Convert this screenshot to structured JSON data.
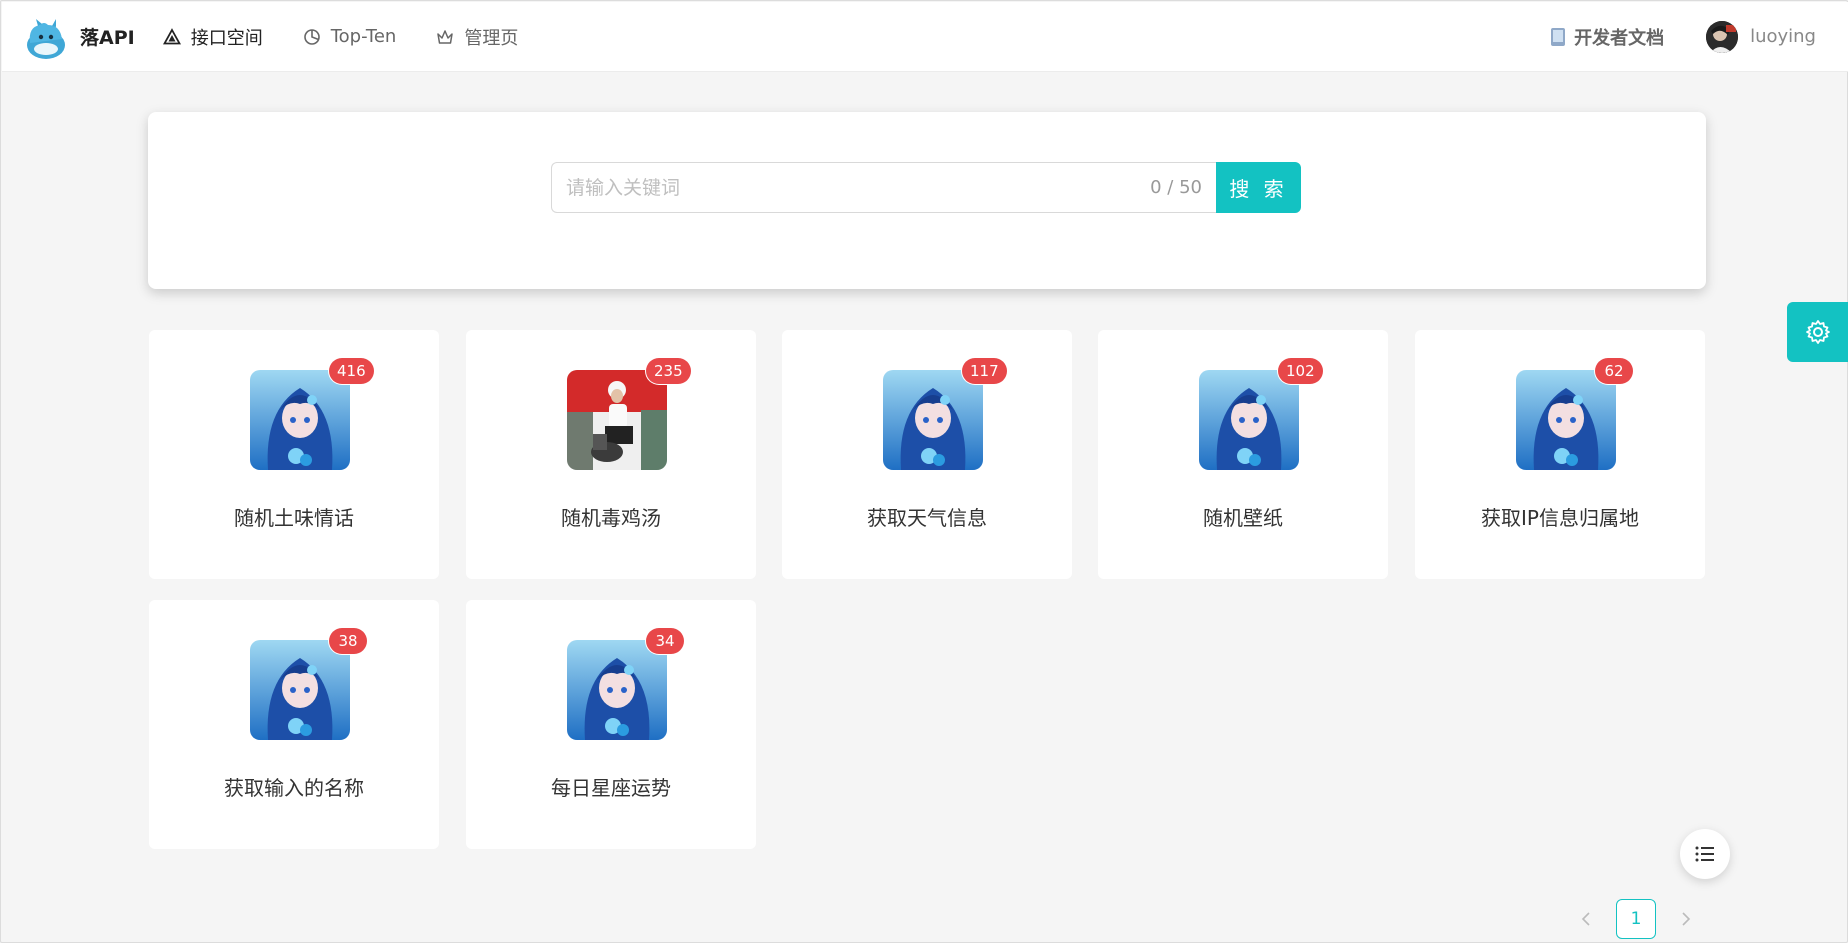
{
  "header": {
    "brand": "落API",
    "nav": [
      {
        "label": "接口空间",
        "icon": "triangle-icon"
      },
      {
        "label": "Top-Ten",
        "icon": "pie-chart-icon"
      },
      {
        "label": "管理页",
        "icon": "crown-icon"
      }
    ],
    "docs_label": "开发者文档",
    "username": "luoying"
  },
  "search": {
    "placeholder": "请输入关键词",
    "value": "",
    "count": "0 / 50",
    "button_label": "搜 索"
  },
  "apis": [
    {
      "name": "随机土味情话",
      "count": "416",
      "image": "anime-girl"
    },
    {
      "name": "随机毒鸡汤",
      "count": "235",
      "image": "person-scooter"
    },
    {
      "name": "获取天气信息",
      "count": "117",
      "image": "anime-girl"
    },
    {
      "name": "随机壁纸",
      "count": "102",
      "image": "anime-girl"
    },
    {
      "name": "获取IP信息归属地",
      "count": "62",
      "image": "anime-girl"
    },
    {
      "name": "获取输入的名称",
      "count": "38",
      "image": "anime-girl"
    },
    {
      "name": "每日星座运势",
      "count": "34",
      "image": "anime-girl"
    }
  ],
  "pagination": {
    "current": "1"
  },
  "colors": {
    "accent": "#13c2c2",
    "badge": "#e84749"
  }
}
